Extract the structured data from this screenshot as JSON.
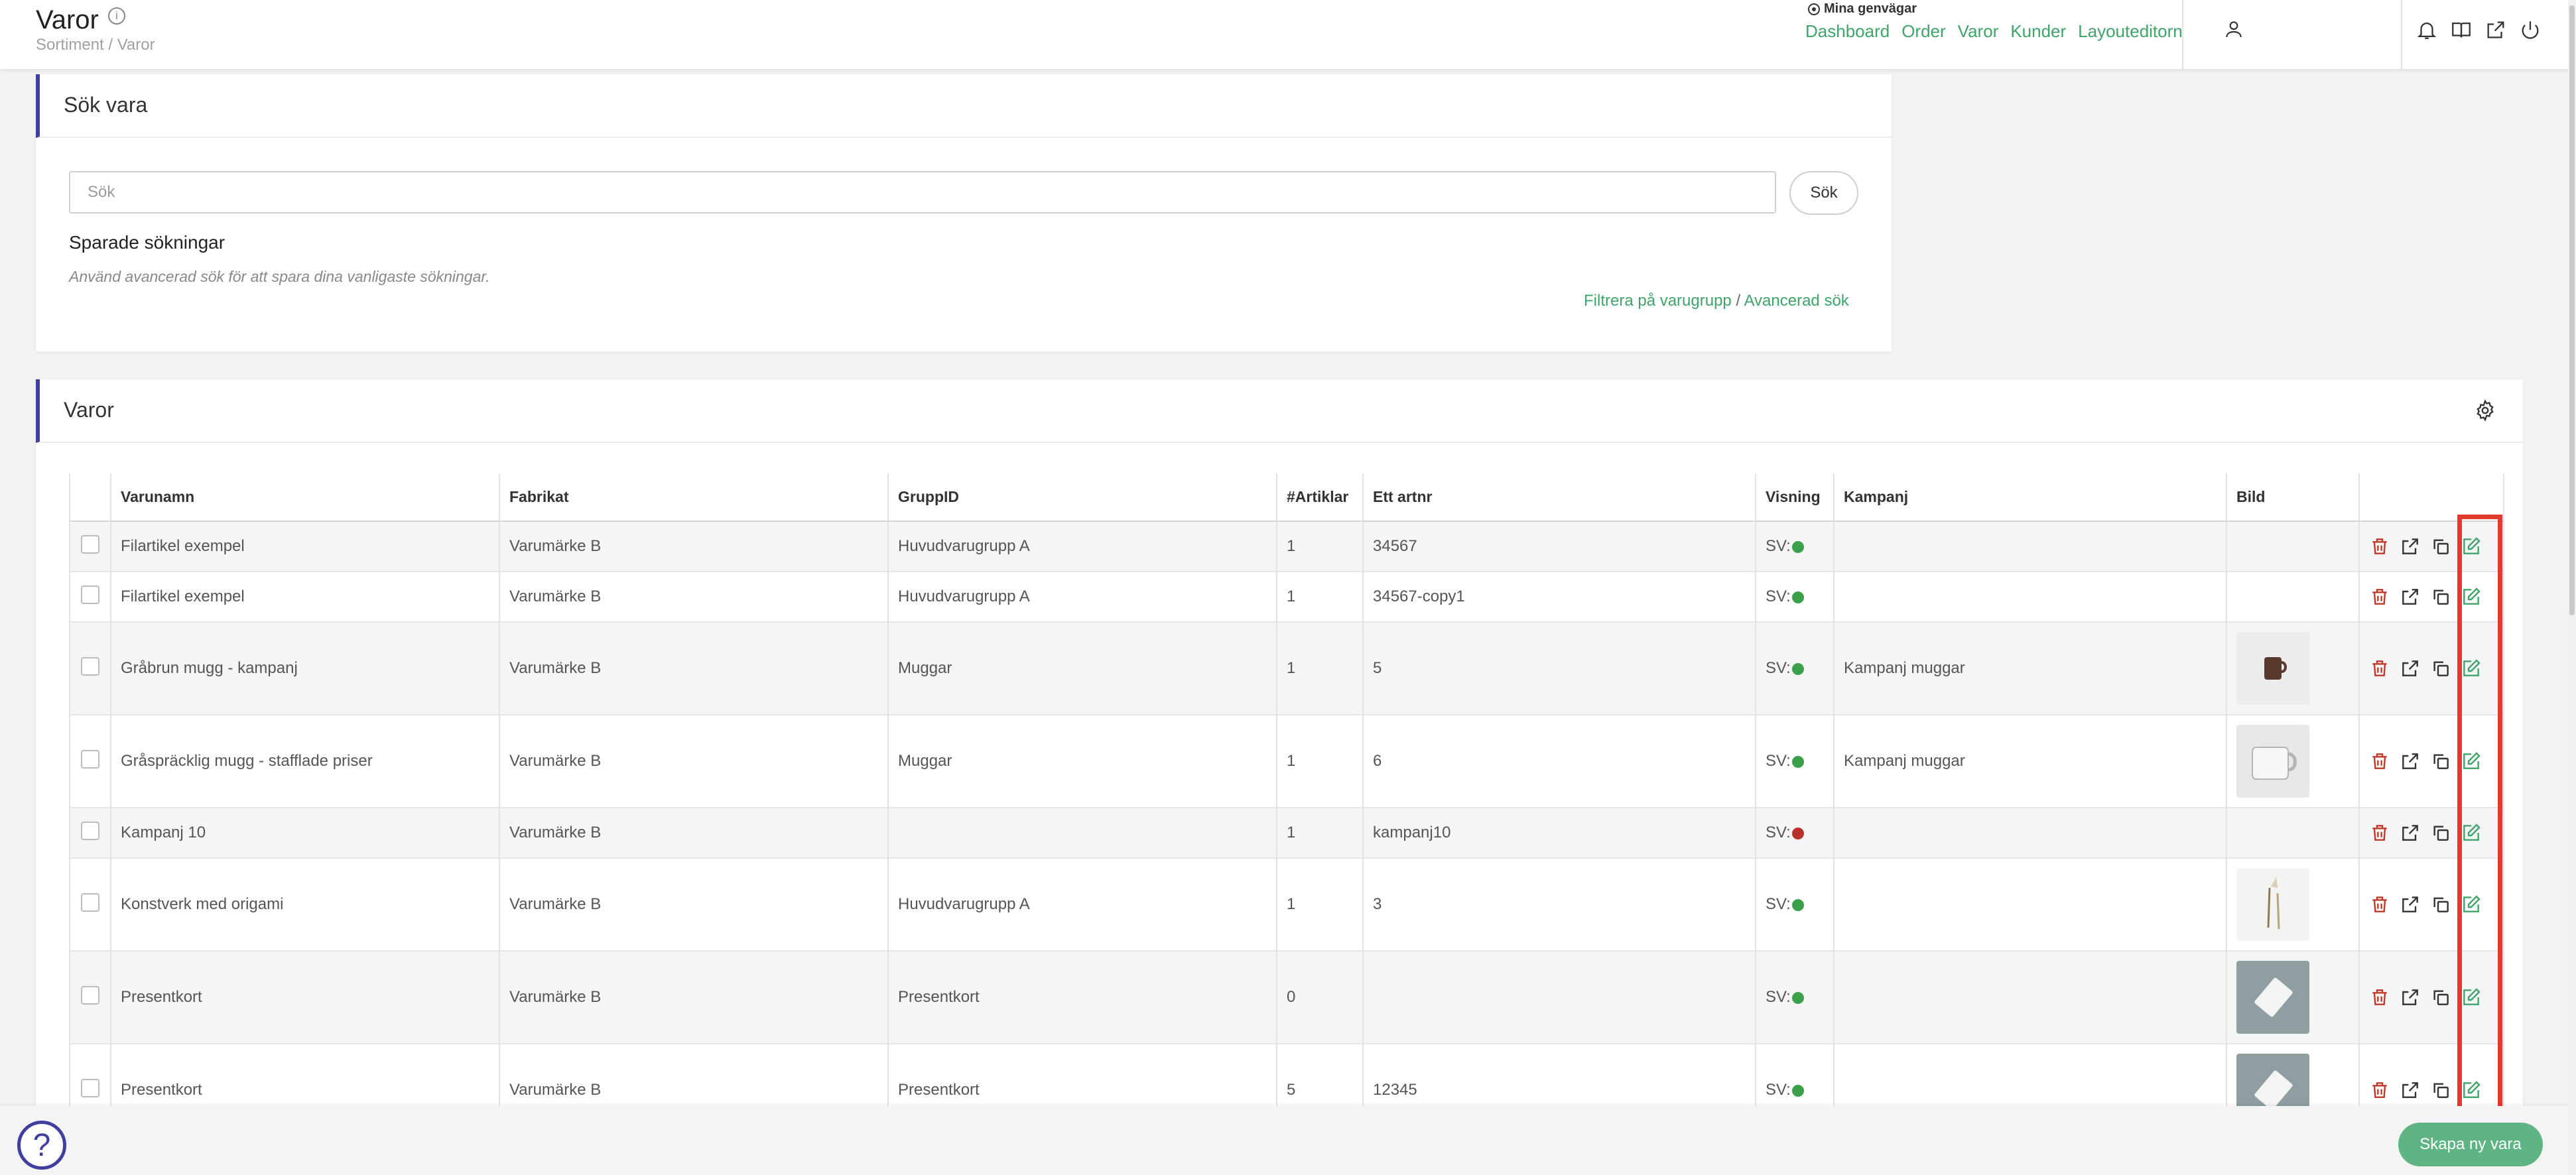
{
  "header": {
    "title": "Varor",
    "breadcrumb": "Sortiment / Varor",
    "shortcuts_label": "Mina genvägar",
    "shortcuts": [
      "Dashboard",
      "Order",
      "Varor",
      "Kunder",
      "Layouteditorn"
    ]
  },
  "search_panel": {
    "title": "Sök vara",
    "placeholder": "Sök",
    "button_label": "Sök",
    "saved_title": "Sparade sökningar",
    "saved_hint": "Använd avancerad sök för att spara dina vanligaste sökningar.",
    "filter_link": "Filtrera på varugrupp",
    "separator": "/",
    "advanced_link": "Avancerad sök"
  },
  "products_panel": {
    "title": "Varor",
    "columns": [
      "Varunamn",
      "Fabrikat",
      "GruppID",
      "#Artiklar",
      "Ett artnr",
      "Visning",
      "Kampanj",
      "Bild"
    ],
    "rows": [
      {
        "name": "Filartikel exempel",
        "brand": "Varumärke B",
        "group": "Huvudvarugrupp A",
        "count": "1",
        "artnr": "34567",
        "display": "SV:",
        "status_color": "#3aa04a",
        "campaign": "",
        "image": "none"
      },
      {
        "name": "Filartikel exempel",
        "brand": "Varumärke B",
        "group": "Huvudvarugrupp A",
        "count": "1",
        "artnr": "34567-copy1",
        "display": "SV:",
        "status_color": "#3aa04a",
        "campaign": "",
        "image": "none"
      },
      {
        "name": "Gråbrun mugg - kampanj",
        "brand": "Varumärke B",
        "group": "Muggar",
        "count": "1",
        "artnr": "5",
        "display": "SV:",
        "status_color": "#3aa04a",
        "campaign": "Kampanj muggar",
        "image": "brown-mug"
      },
      {
        "name": "Gråspräcklig mugg - stafflade priser",
        "brand": "Varumärke B",
        "group": "Muggar",
        "count": "1",
        "artnr": "6",
        "display": "SV:",
        "status_color": "#3aa04a",
        "campaign": "Kampanj muggar",
        "image": "grey-mug"
      },
      {
        "name": "Kampanj 10",
        "brand": "Varumärke B",
        "group": "",
        "count": "1",
        "artnr": "kampanj10",
        "display": "SV:",
        "status_color": "#b8322a",
        "campaign": "",
        "image": "none"
      },
      {
        "name": "Konstverk med origami",
        "brand": "Varumärke B",
        "group": "Huvudvarugrupp A",
        "count": "1",
        "artnr": "3",
        "display": "SV:",
        "status_color": "#3aa04a",
        "campaign": "",
        "image": "origami"
      },
      {
        "name": "Presentkort",
        "brand": "Varumärke B",
        "group": "Presentkort",
        "count": "0",
        "artnr": "",
        "display": "SV:",
        "status_color": "#3aa04a",
        "campaign": "",
        "image": "gift-card"
      },
      {
        "name": "Presentkort",
        "brand": "Varumärke B",
        "group": "Presentkort",
        "count": "5",
        "artnr": "12345",
        "display": "SV:",
        "status_color": "#3aa04a",
        "campaign": "",
        "image": "gift-card"
      }
    ]
  },
  "footer": {
    "help_label": "?",
    "create_button": "Skapa ny vara"
  },
  "colors": {
    "accent_green": "#3fa469",
    "panel_border": "#3f3f9f",
    "delete_red": "#c0392b",
    "highlight": "#e03b2e"
  }
}
